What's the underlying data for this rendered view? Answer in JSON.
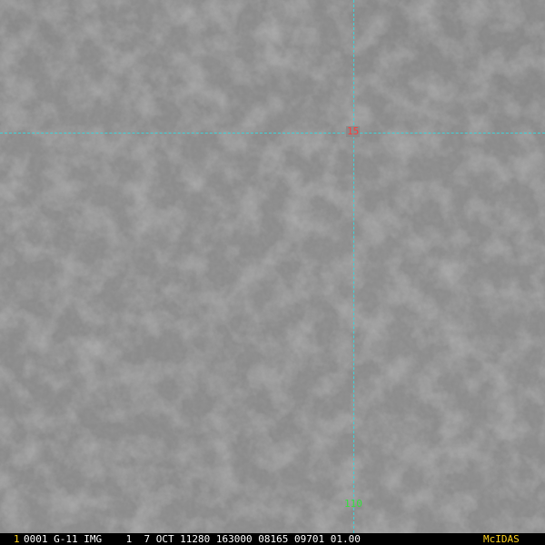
{
  "colors": {
    "grid": "#3fd2d8",
    "lat_label": "#ff3b3b",
    "lon_label": "#34e03c",
    "status_text": "#ffffff",
    "frame_number": "#ffd21e",
    "brand": "#ffd21e",
    "status_bg": "#000000"
  },
  "overlay": {
    "lat_label": "15",
    "lon_label": "110"
  },
  "status": {
    "frame_number": "1",
    "info": "0001 G-11 IMG    1  7 OCT 11280 163000 08165 09701 01.00",
    "brand": "McIDAS"
  }
}
